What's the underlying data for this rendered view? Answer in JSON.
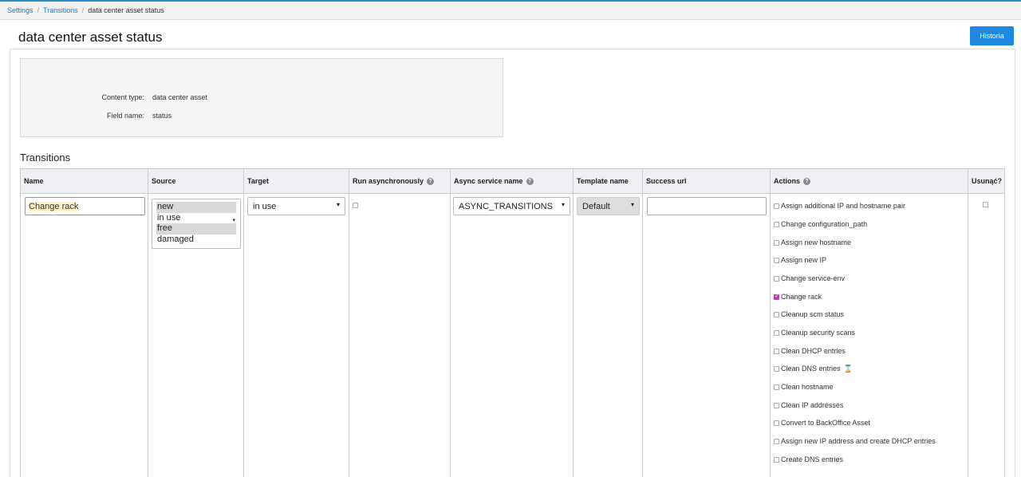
{
  "breadcrumb": {
    "items": [
      "Settings",
      "Transitions"
    ],
    "current": "data center asset status"
  },
  "page": {
    "title": "data center asset status",
    "history_button": "Historia"
  },
  "info": {
    "content_type_label": "Content type:",
    "content_type_value": "data center asset",
    "field_name_label": "Field name:",
    "field_name_value": "status"
  },
  "transitions": {
    "title": "Transitions",
    "columns": {
      "name": "Name",
      "source": "Source",
      "target": "Target",
      "run_async": "Run asynchronously",
      "async_service": "Async service name",
      "template": "Template name",
      "success_url": "Success url",
      "actions": "Actions",
      "delete": "Usunąć?"
    },
    "row": {
      "name": "Change rack",
      "source_options": [
        {
          "label": "new",
          "selected": true
        },
        {
          "label": "in use",
          "selected": false
        },
        {
          "label": "free",
          "selected": true
        },
        {
          "label": "damaged",
          "selected": false
        }
      ],
      "target": "in use",
      "run_async": false,
      "async_service": "ASYNC_TRANSITIONS",
      "template": "Default",
      "success_url": "",
      "actions": [
        {
          "label": "Assign additional IP and hostname pair",
          "checked": false
        },
        {
          "label": "Change configuration_path",
          "checked": false
        },
        {
          "label": "Assign new hostname",
          "checked": false
        },
        {
          "label": "Assign new IP",
          "checked": false
        },
        {
          "label": "Change service-env",
          "checked": false
        },
        {
          "label": "Change rack",
          "checked": true
        },
        {
          "label": "Cleanup scm status",
          "checked": false
        },
        {
          "label": "Cleanup security scans",
          "checked": false
        },
        {
          "label": "Clean DHCP entries",
          "checked": false
        },
        {
          "label": "Clean DNS entries",
          "checked": false,
          "icon": "hourglass-icon"
        },
        {
          "label": "Clean hostname",
          "checked": false
        },
        {
          "label": "Clean IP addresses",
          "checked": false
        },
        {
          "label": "Convert to BackOffice Asset",
          "checked": false
        },
        {
          "label": "Assign new IP address and create DHCP entries",
          "checked": false
        },
        {
          "label": "Create DNS entries",
          "checked": false
        }
      ],
      "delete": false
    }
  },
  "colors": {
    "accent": "#1e88e5",
    "link": "#1a7bc9",
    "checked": "#b048b0"
  }
}
